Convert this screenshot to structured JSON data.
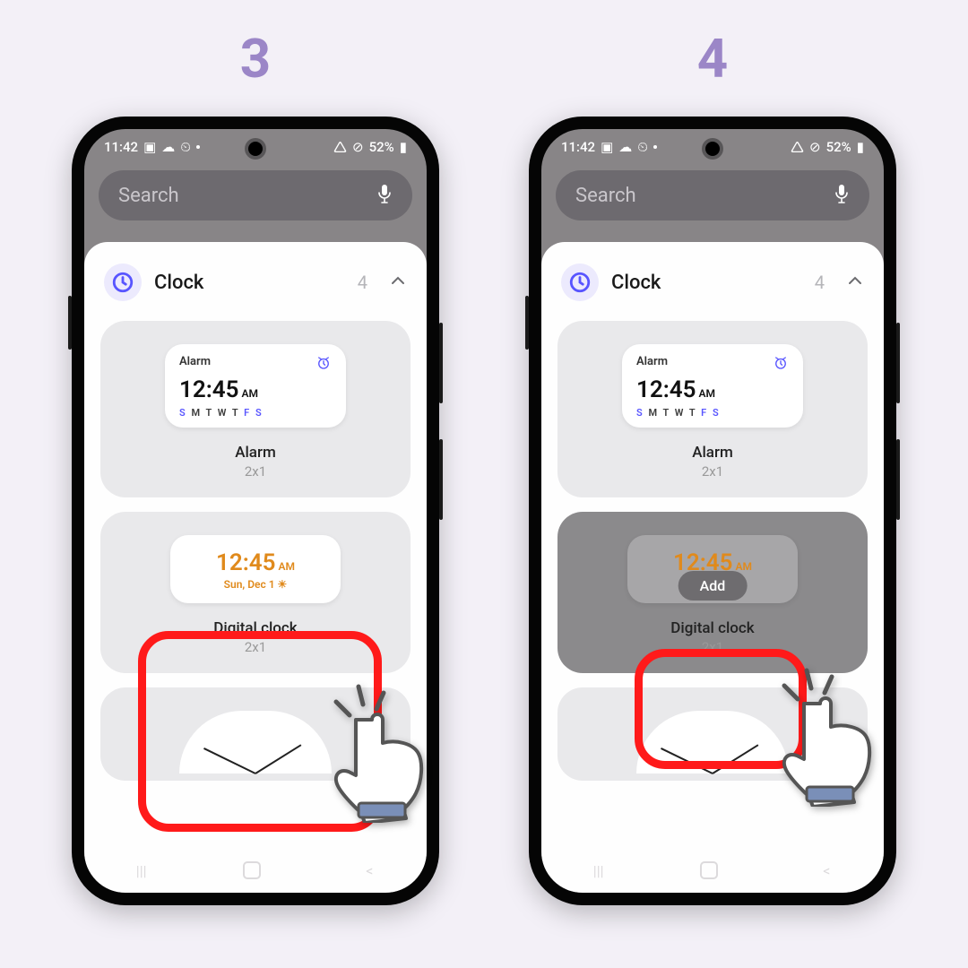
{
  "steps": {
    "one": "3",
    "two": "4"
  },
  "status": {
    "time": "11:42",
    "battery": "52%"
  },
  "search": {
    "placeholder": "Search"
  },
  "header": {
    "app": "Clock",
    "count": "4"
  },
  "widgets": {
    "alarm": {
      "label": "Alarm",
      "time": "12:45",
      "ampm": "AM",
      "days": "S M T W T F S",
      "name": "Alarm",
      "size": "2x1"
    },
    "digital": {
      "time": "12:45",
      "ampm": "AM",
      "date": "Sun, Dec 1 ☀",
      "name": "Digital clock",
      "size": "2x1"
    },
    "add_button": "Add"
  }
}
